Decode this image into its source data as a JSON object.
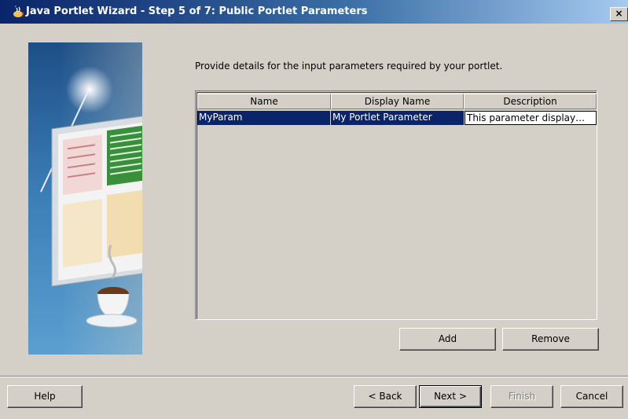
{
  "window": {
    "title": "Java Portlet Wizard - Step 5 of 7: Public Portlet Parameters",
    "close_label": "×",
    "title_icon": "java-wizard-icon"
  },
  "main": {
    "instruction": "Provide details for the input parameters required by your portlet."
  },
  "table": {
    "columns": [
      "Name",
      "Display Name",
      "Description"
    ],
    "rows": [
      {
        "name": "MyParam",
        "display_name": "My Portlet Parameter",
        "description": "This parameter display…"
      }
    ]
  },
  "buttons": {
    "add": "Add",
    "remove": "Remove"
  },
  "footer": {
    "help": "Help",
    "back": "< Back",
    "next": "Next >",
    "finish": "Finish",
    "cancel": "Cancel"
  },
  "colors": {
    "dialog_bg": "#d4d0c8",
    "title_gradient_start": "#0a246a",
    "selection": "#0a246a"
  }
}
